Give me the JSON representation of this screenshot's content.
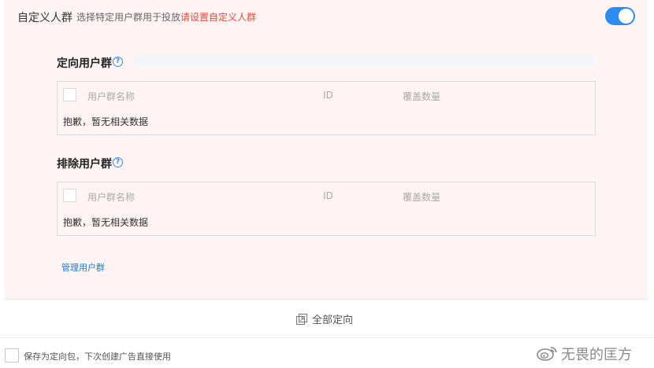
{
  "custom_group": {
    "title": "自定义人群",
    "description": "选择特定用户群用于投放",
    "link": "请设置自定义人群",
    "enabled": true,
    "accent_color": "#2d8cf0",
    "link_color": "#e5493a"
  },
  "include_section": {
    "title": "定向用户群",
    "help_icon": "question-icon",
    "columns": [
      "用户群名称",
      "ID",
      "覆盖数量"
    ],
    "empty_text": "抱歉，暂无相关数据"
  },
  "exclude_section": {
    "title": "排除用户群",
    "help_icon": "question-icon",
    "columns": [
      "用户群名称",
      "ID",
      "覆盖数量"
    ],
    "empty_text": "抱歉，暂无相关数据"
  },
  "manage_link": "管理用户群",
  "all_targeting": {
    "label": "全部定向",
    "icon": "collapse-icon"
  },
  "save_option": {
    "label": "保存为定向包，下次创建广告直接使用",
    "checked": false
  },
  "watermark": {
    "icon": "weibo-icon",
    "text": "无畏的匡方"
  }
}
